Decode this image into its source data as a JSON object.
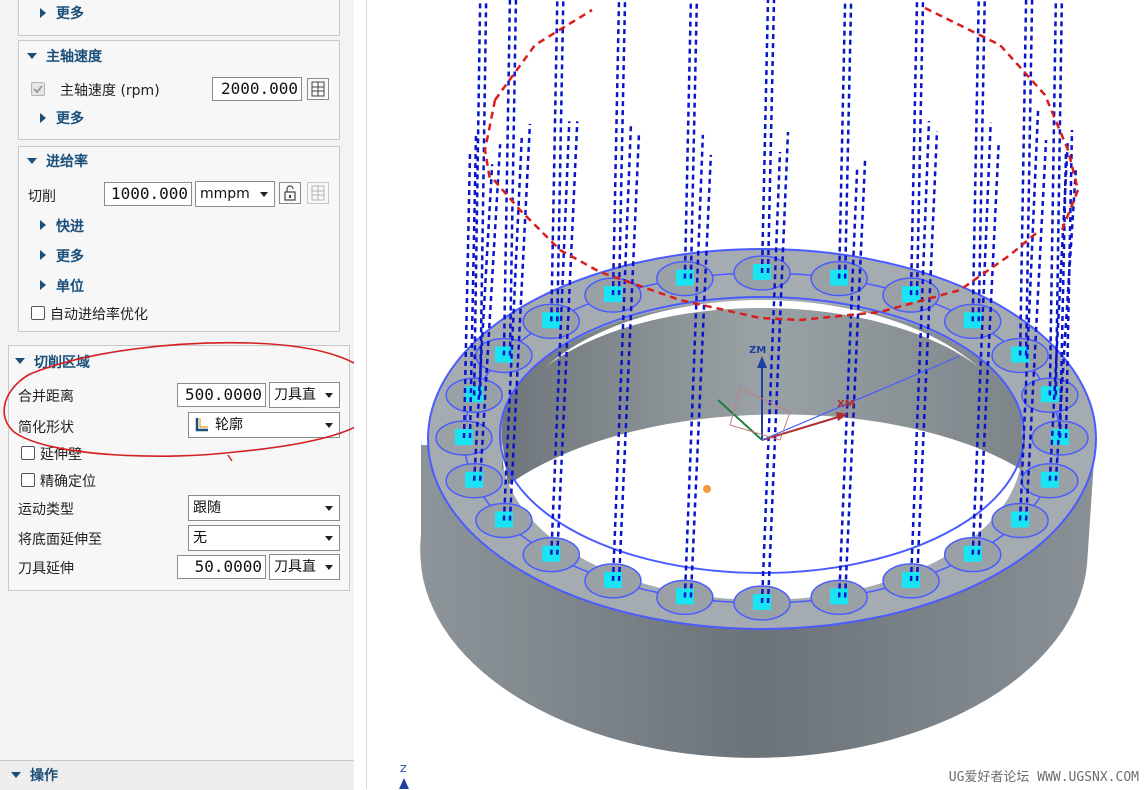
{
  "panel": {
    "more_top": "更多",
    "spindle": {
      "header": "主轴速度",
      "label": "主轴速度 (rpm)",
      "value": "2000.000",
      "more": "更多"
    },
    "feed": {
      "header": "进给率",
      "cut_label": "切削",
      "cut_value": "1000.000",
      "cut_unit": "mmpm",
      "rapid": "快进",
      "more": "更多",
      "units": "单位",
      "auto_optimize": "自动进给率优化"
    },
    "cut_region": {
      "header": "切削区域",
      "merge_label": "合并距离",
      "merge_value": "500.0000",
      "merge_unit": "刀具直",
      "simplify_label": "简化形状",
      "simplify_value": "轮廓",
      "extend_wall": "延伸壁",
      "precise_position": "精确定位",
      "motion_label": "运动类型",
      "motion_value": "跟随",
      "floor_label": "将底面延伸至",
      "floor_value": "无",
      "tool_ext_label": "刀具延伸",
      "tool_ext_value": "50.0000",
      "tool_ext_unit": "刀具直"
    },
    "operation": {
      "header": "操作"
    }
  },
  "viewport": {
    "axis_zm": "ZM",
    "axis_xm": "XM",
    "axis_z": "Z",
    "watermark": "UG爱好者论坛 WWW.UGSNX.COM"
  },
  "colors": {
    "header_blue": "#1a4f7a",
    "toolpath_blue": "#0a14c8",
    "rapid_red": "#d81e1e",
    "hole_cyan": "#18e4f4",
    "edge_blue": "#4a5cff",
    "annotation_red": "#d42020"
  }
}
